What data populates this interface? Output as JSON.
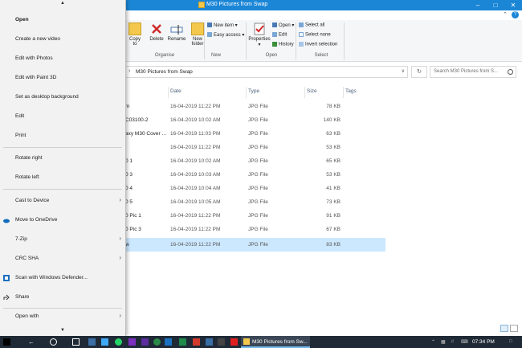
{
  "window": {
    "title": "M30 Pictures from Swap",
    "controls": [
      "minimize",
      "maximize",
      "close"
    ]
  },
  "ribbon": {
    "clipboard": {
      "copy_to_label": "Copy",
      "copy_to_sub": "to"
    },
    "organize": {
      "delete_label": "Delete",
      "rename_label": "Rename",
      "group_label": "Organise"
    },
    "new": {
      "new_folder_label": "New",
      "new_folder_sub": "folder",
      "new_item_label": "New item",
      "easy_access_label": "Easy access",
      "group_label": "New"
    },
    "open": {
      "properties_label": "Properties",
      "open_label": "Open",
      "edit_label": "Edit",
      "history_label": "History",
      "group_label": "Open"
    },
    "select": {
      "select_all_label": "Select all",
      "select_none_label": "Select none",
      "invert_selection_label": "Invert selection",
      "group_label": "Select"
    }
  },
  "address": {
    "path": "M30 Pictures from Swap",
    "search_placeholder": "Search M30 Pictures from S..."
  },
  "columns": {
    "date": "Date",
    "type": "Type",
    "size": "Size",
    "tags": "Tags"
  },
  "files": [
    {
      "name": "m",
      "date": "16-04-2019 11:22 PM",
      "type": "JPG File",
      "size": "78 KB",
      "selected": false
    },
    {
      "name": "C03100-2",
      "date": "16-04-2019 10:02 AM",
      "type": "JPG File",
      "size": "140 KB",
      "selected": false
    },
    {
      "name": "axy M30 Cover ...",
      "date": "16-04-2019 11:03 PM",
      "type": "JPG File",
      "size": "63 KB",
      "selected": false
    },
    {
      "name": "",
      "date": "16-04-2019 11:22 PM",
      "type": "JPG File",
      "size": "53 KB",
      "selected": false
    },
    {
      "name": "0 1",
      "date": "16-04-2019 10:02 AM",
      "type": "JPG File",
      "size": "65 KB",
      "selected": false
    },
    {
      "name": "0 3",
      "date": "16-04-2019 10:03 AM",
      "type": "JPG File",
      "size": "53 KB",
      "selected": false
    },
    {
      "name": "0 4",
      "date": "16-04-2019 10:04 AM",
      "type": "JPG File",
      "size": "41 KB",
      "selected": false
    },
    {
      "name": "0 5",
      "date": "16-04-2019 10:05 AM",
      "type": "JPG File",
      "size": "73 KB",
      "selected": false
    },
    {
      "name": "0 Pic 1",
      "date": "16-04-2019 11:22 PM",
      "type": "JPG File",
      "size": "91 KB",
      "selected": false
    },
    {
      "name": "0 Pic 3",
      "date": "16-04-2019 11:22 PM",
      "type": "JPG File",
      "size": "67 KB",
      "selected": false
    },
    {
      "name": "w",
      "date": "16-04-2019 11:22 PM",
      "type": "JPG File",
      "size": "83 KB",
      "selected": true
    }
  ],
  "context_menu": {
    "items": [
      {
        "label": "Open",
        "bold": true,
        "submenu": false,
        "icon": ""
      },
      {
        "label": "Create a new video",
        "bold": false,
        "submenu": false,
        "icon": ""
      },
      {
        "label": "Edit with Photos",
        "bold": false,
        "submenu": false,
        "icon": ""
      },
      {
        "label": "Edit with Paint 3D",
        "bold": false,
        "submenu": false,
        "icon": ""
      },
      {
        "label": "Set as desktop background",
        "bold": false,
        "submenu": false,
        "icon": ""
      },
      {
        "label": "Edit",
        "bold": false,
        "submenu": false,
        "icon": ""
      },
      {
        "label": "Print",
        "bold": false,
        "submenu": false,
        "icon": ""
      },
      {
        "label": "Rotate right",
        "bold": false,
        "submenu": false,
        "icon": ""
      },
      {
        "label": "Rotate left",
        "bold": false,
        "submenu": false,
        "icon": ""
      },
      {
        "label": "Cast to Device",
        "bold": false,
        "submenu": true,
        "icon": ""
      },
      {
        "label": "Move to OneDrive",
        "bold": false,
        "submenu": false,
        "icon": "onedrive-icon"
      },
      {
        "label": "7-Zip",
        "bold": false,
        "submenu": true,
        "icon": ""
      },
      {
        "label": "CRC SHA",
        "bold": false,
        "submenu": true,
        "icon": ""
      },
      {
        "label": "Scan with Windows Defender...",
        "bold": false,
        "submenu": false,
        "icon": "defender-icon"
      },
      {
        "label": "Share",
        "bold": false,
        "submenu": false,
        "icon": "share-icon"
      },
      {
        "label": "Open with",
        "bold": false,
        "submenu": true,
        "icon": ""
      }
    ]
  },
  "taskbar": {
    "active_window_label": "M30 Pictures from Sw...",
    "time": "07:34 PM"
  },
  "colors": {
    "titlebar": "#1b86d6",
    "selection": "#cce8ff",
    "taskbar": "#1f2a36",
    "menu_bg": "#f2f2f2"
  }
}
